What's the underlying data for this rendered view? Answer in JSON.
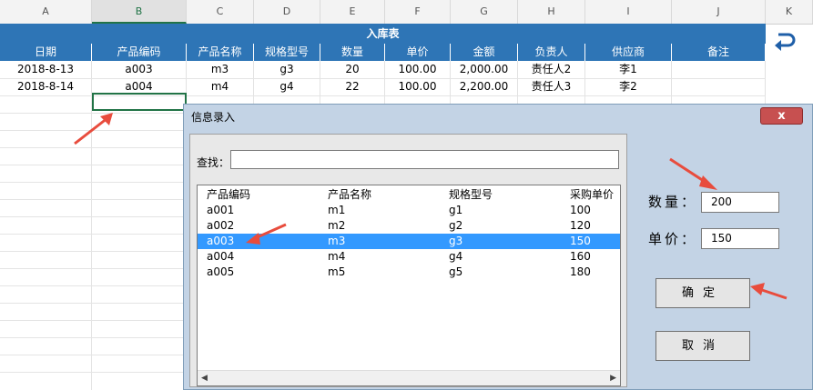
{
  "sheet": {
    "columns": [
      "A",
      "B",
      "C",
      "D",
      "E",
      "F",
      "G",
      "H",
      "I",
      "J",
      "K"
    ],
    "selected_column": "B",
    "title": "入库表",
    "headers": [
      "日期",
      "产品编码",
      "产品名称",
      "规格型号",
      "数量",
      "单价",
      "金额",
      "负责人",
      "供应商",
      "备注"
    ],
    "rows": [
      [
        "2018-8-13",
        "a003",
        "m3",
        "g3",
        "20",
        "100.00",
        "2,000.00",
        "责任人2",
        "李1",
        ""
      ],
      [
        "2018-8-14",
        "a004",
        "m4",
        "g4",
        "22",
        "100.00",
        "2,200.00",
        "责任人3",
        "李2",
        ""
      ]
    ],
    "undo_icon": "undo-arrow-icon",
    "header_color": "#2e75b6"
  },
  "dialog": {
    "title": "信息录入",
    "close_label": "x",
    "search_label": "查找：",
    "search_value": "",
    "list_headers": [
      "产品编码",
      "产品名称",
      "规格型号",
      "采购单价"
    ],
    "list_rows": [
      [
        "a001",
        "m1",
        "g1",
        "100"
      ],
      [
        "a002",
        "m2",
        "g2",
        "120"
      ],
      [
        "a003",
        "m3",
        "g3",
        "150"
      ],
      [
        "a004",
        "m4",
        "g4",
        "160"
      ],
      [
        "a005",
        "m5",
        "g5",
        "180"
      ]
    ],
    "selected_row": 2,
    "qty_label": "数量：",
    "qty_value": "200",
    "price_label": "单价：",
    "price_value": "150",
    "ok_label": "确定",
    "cancel_label": "取消",
    "highlight_color": "#3399ff"
  }
}
